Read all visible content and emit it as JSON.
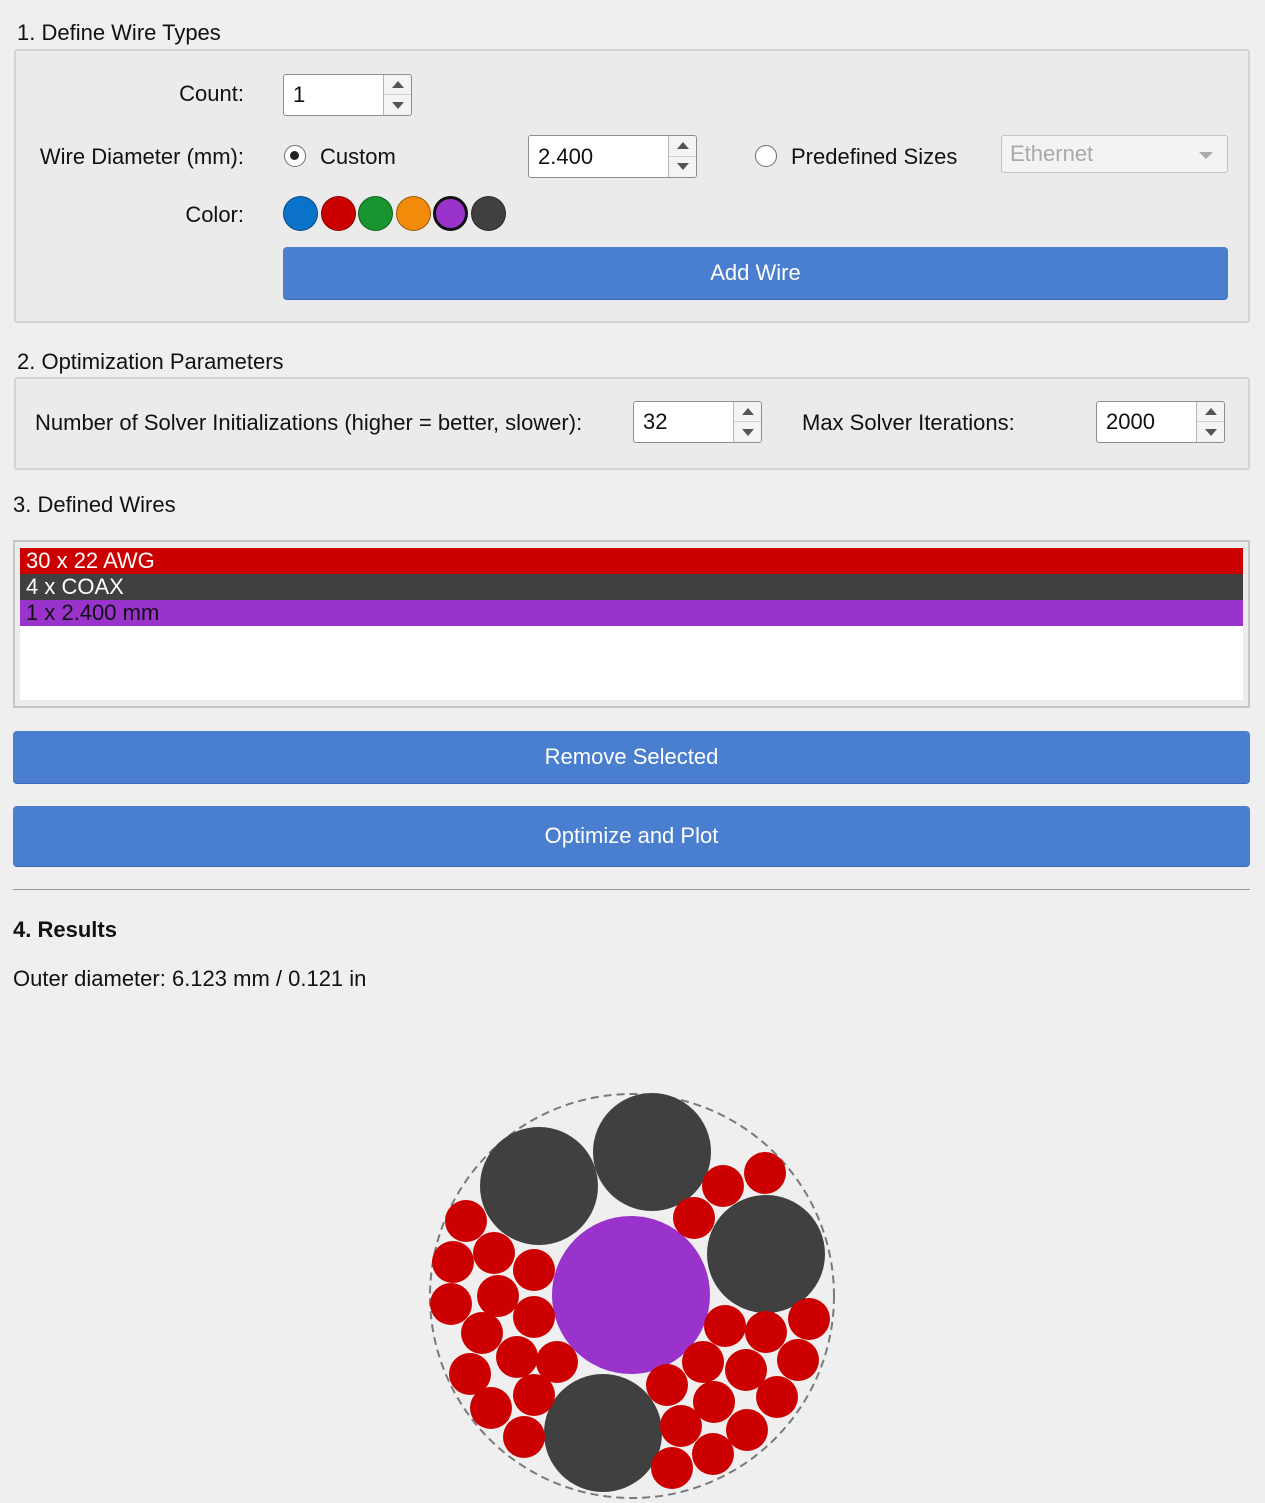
{
  "define": {
    "title": "1. Define Wire Types",
    "count_label": "Count:",
    "count_value": "1",
    "diameter_label": "Wire Diameter (mm):",
    "custom_label": "Custom",
    "custom_selected": true,
    "custom_value": "2.400",
    "predefined_label": "Predefined Sizes",
    "predefined_selected": false,
    "predefined_value": "Ethernet",
    "color_label": "Color:",
    "colors": [
      "#0a72c8",
      "#cc0000",
      "#18952e",
      "#f28a0a",
      "#9933cc",
      "#404040"
    ],
    "selected_color": "#9933cc",
    "add_button": "Add Wire"
  },
  "optimization": {
    "title": "2. Optimization Parameters",
    "inits_label": "Number of Solver Initializations (higher = better, slower):",
    "inits_value": "32",
    "iters_label": "Max Solver Iterations:",
    "iters_value": "2000"
  },
  "wires": {
    "title": "3. Defined Wires",
    "items": [
      {
        "label": "30 x 22 AWG",
        "color": "#cc0000",
        "text_color": "#ffffff"
      },
      {
        "label": "4 x COAX",
        "color": "#404040",
        "text_color": "#ffffff"
      },
      {
        "label": "1 x 2.400 mm",
        "color": "#9933cc",
        "text_color": "#111111"
      }
    ],
    "remove_button": "Remove Selected",
    "optimize_button": "Optimize and Plot"
  },
  "results": {
    "title": "4. Results",
    "outer_diameter": "Outer diameter: 6.123 mm / 0.121 in"
  }
}
